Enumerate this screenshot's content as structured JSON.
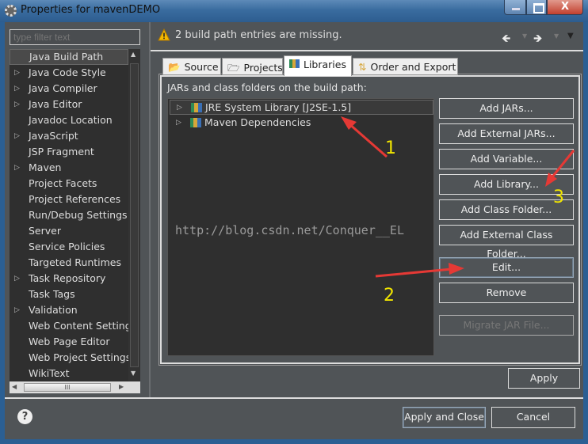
{
  "window": {
    "title": "Properties for mavenDEMO",
    "close_label": "X"
  },
  "filter": {
    "placeholder": "type filter text"
  },
  "sidebar": {
    "items": [
      {
        "label": "Java Build Path",
        "expandable": false,
        "selected": true
      },
      {
        "label": "Java Code Style",
        "expandable": true
      },
      {
        "label": "Java Compiler",
        "expandable": true
      },
      {
        "label": "Java Editor",
        "expandable": true
      },
      {
        "label": "Javadoc Location",
        "expandable": false
      },
      {
        "label": "JavaScript",
        "expandable": true
      },
      {
        "label": "JSP Fragment",
        "expandable": false
      },
      {
        "label": "Maven",
        "expandable": true
      },
      {
        "label": "Project Facets",
        "expandable": false
      },
      {
        "label": "Project References",
        "expandable": false
      },
      {
        "label": "Run/Debug Settings",
        "expandable": false
      },
      {
        "label": "Server",
        "expandable": false
      },
      {
        "label": "Service Policies",
        "expandable": false
      },
      {
        "label": "Targeted Runtimes",
        "expandable": false
      },
      {
        "label": "Task Repository",
        "expandable": true
      },
      {
        "label": "Task Tags",
        "expandable": false
      },
      {
        "label": "Validation",
        "expandable": true
      },
      {
        "label": "Web Content Settings",
        "expandable": false
      },
      {
        "label": "Web Page Editor",
        "expandable": false
      },
      {
        "label": "Web Project Settings",
        "expandable": false
      },
      {
        "label": "WikiText",
        "expandable": false
      }
    ],
    "hscroll_grip": "III"
  },
  "message": {
    "text": "2 build path entries are missing."
  },
  "tabs": [
    {
      "label": "Source"
    },
    {
      "label": "Projects"
    },
    {
      "label": "Libraries",
      "active": true
    },
    {
      "label": "Order and Export"
    }
  ],
  "libraries": {
    "label": "JARs and class folders on the build path:",
    "entries": [
      {
        "label": "JRE System Library [J2SE-1.5]"
      },
      {
        "label": "Maven Dependencies"
      }
    ]
  },
  "buttons": {
    "add_jars": "Add JARs...",
    "add_external_jars": "Add External JARs...",
    "add_variable": "Add Variable...",
    "add_library": "Add Library...",
    "add_class_folder": "Add Class Folder...",
    "add_external_class_folder": "Add External Class Folder...",
    "edit": "Edit...",
    "remove": "Remove",
    "migrate": "Migrate JAR File...",
    "apply": "Apply",
    "apply_and_close": "Apply and Close",
    "cancel": "Cancel"
  },
  "watermark": "http://blog.csdn.net/Conquer__EL",
  "annotations": [
    "1",
    "2",
    "3"
  ],
  "colors": {
    "background": "#505457",
    "list": "#2f2f2f",
    "annotation_arrow": "#e53935",
    "annotation_number": "#f2e600"
  }
}
